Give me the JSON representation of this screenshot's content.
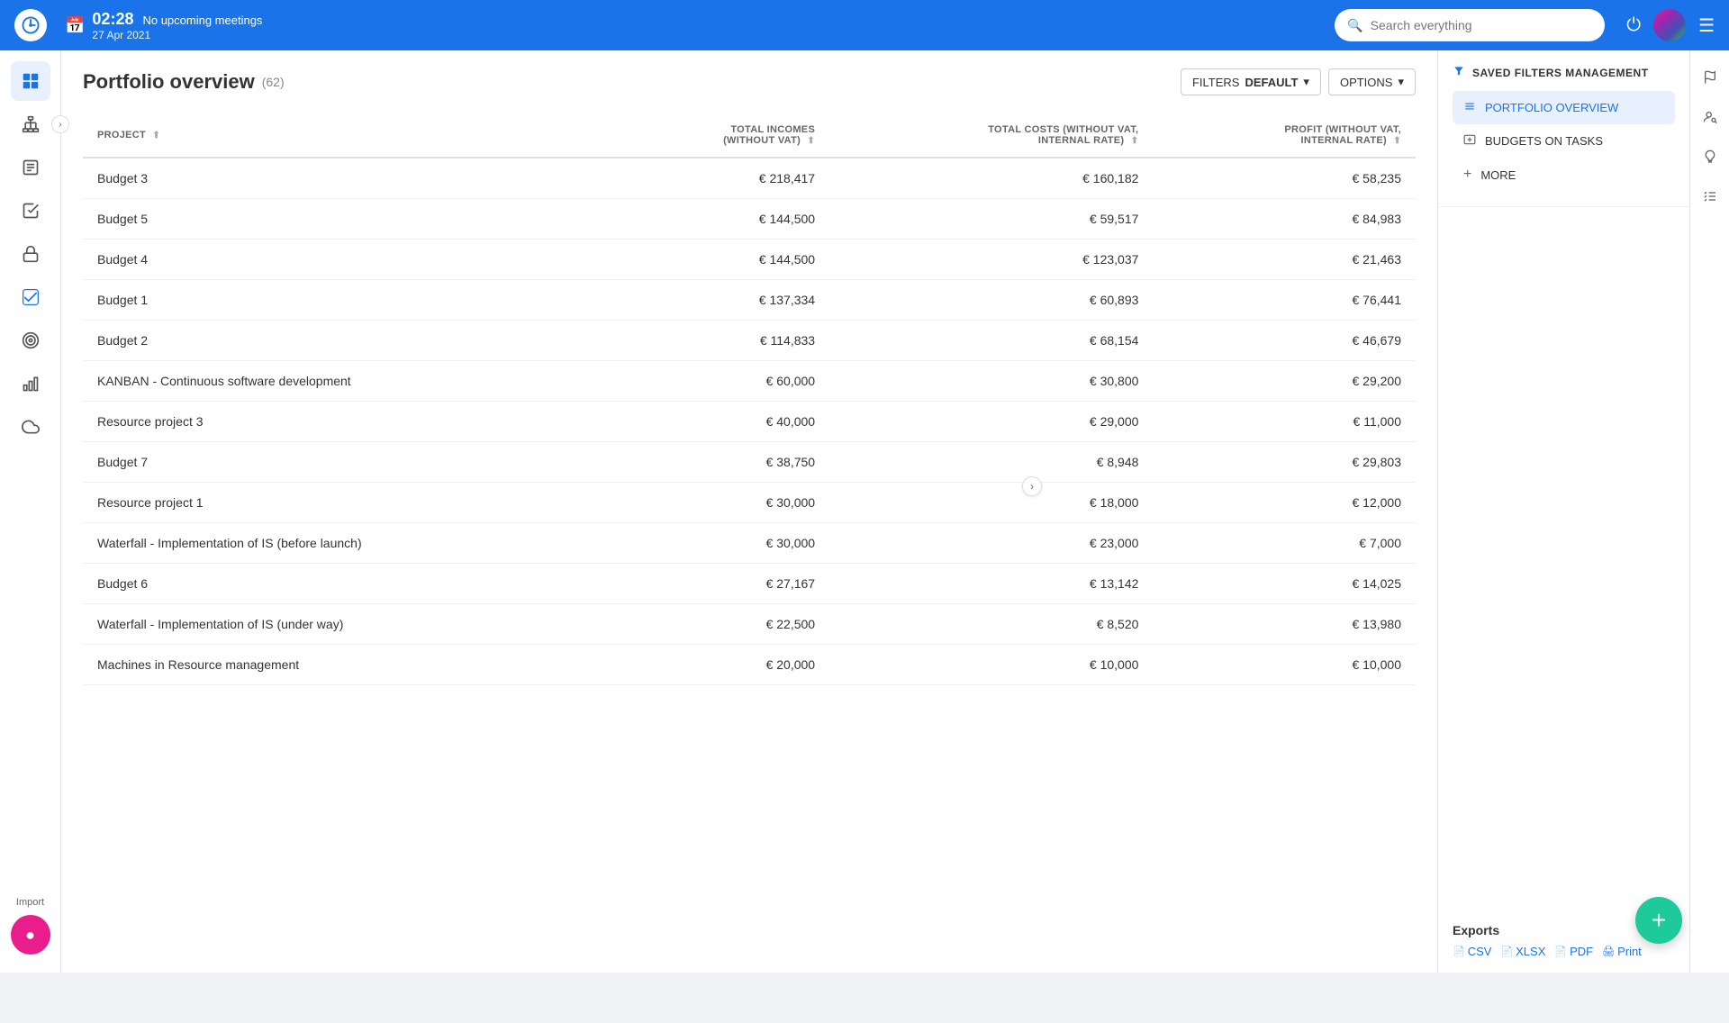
{
  "topnav": {
    "time": "02:28",
    "meeting_status": "No upcoming meetings",
    "date": "27 Apr 2021",
    "search_placeholder": "Search everything"
  },
  "page": {
    "title": "Portfolio overview",
    "count": "(62)",
    "filters_label": "FILTERS",
    "filters_value": "DEFAULT",
    "options_label": "OPTIONS"
  },
  "table": {
    "columns": [
      {
        "id": "project",
        "label": "PROJECT"
      },
      {
        "id": "total_incomes",
        "label": "TOTAL INCOMES (WITHOUT VAT)"
      },
      {
        "id": "total_costs",
        "label": "TOTAL COSTS (WITHOUT VAT, INTERNAL RATE)"
      },
      {
        "id": "profit",
        "label": "PROFIT (WITHOUT VAT, INTERNAL RATE)"
      }
    ],
    "rows": [
      {
        "project": "Budget 3",
        "total_incomes": "€ 218,417",
        "total_costs": "€ 160,182",
        "profit": "€ 58,235"
      },
      {
        "project": "Budget 5",
        "total_incomes": "€ 144,500",
        "total_costs": "€ 59,517",
        "profit": "€ 84,983"
      },
      {
        "project": "Budget 4",
        "total_incomes": "€ 144,500",
        "total_costs": "€ 123,037",
        "profit": "€ 21,463"
      },
      {
        "project": "Budget 1",
        "total_incomes": "€ 137,334",
        "total_costs": "€ 60,893",
        "profit": "€ 76,441"
      },
      {
        "project": "Budget 2",
        "total_incomes": "€ 114,833",
        "total_costs": "€ 68,154",
        "profit": "€ 46,679"
      },
      {
        "project": "KANBAN - Continuous software development",
        "total_incomes": "€ 60,000",
        "total_costs": "€ 30,800",
        "profit": "€ 29,200"
      },
      {
        "project": "Resource project 3",
        "total_incomes": "€ 40,000",
        "total_costs": "€ 29,000",
        "profit": "€ 11,000"
      },
      {
        "project": "Budget 7",
        "total_incomes": "€ 38,750",
        "total_costs": "€ 8,948",
        "profit": "€ 29,803"
      },
      {
        "project": "Resource project 1",
        "total_incomes": "€ 30,000",
        "total_costs": "€ 18,000",
        "profit": "€ 12,000"
      },
      {
        "project": "Waterfall - Implementation of IS (before launch)",
        "total_incomes": "€ 30,000",
        "total_costs": "€ 23,000",
        "profit": "€ 7,000"
      },
      {
        "project": "Budget 6",
        "total_incomes": "€ 27,167",
        "total_costs": "€ 13,142",
        "profit": "€ 14,025"
      },
      {
        "project": "Waterfall - Implementation of IS (under way)",
        "total_incomes": "€ 22,500",
        "total_costs": "€ 8,520",
        "profit": "€ 13,980"
      },
      {
        "project": "Machines in Resource management",
        "total_incomes": "€ 20,000",
        "total_costs": "€ 10,000",
        "profit": "€ 10,000"
      }
    ]
  },
  "right_panel": {
    "saved_filters_label": "SAVED FILTERS MANAGEMENT",
    "menu_items": [
      {
        "id": "portfolio-overview",
        "label": "PORTFOLIO OVERVIEW",
        "active": true
      },
      {
        "id": "budgets-on-tasks",
        "label": "BUDGETS ON TASKS",
        "active": false
      }
    ],
    "more_label": "MORE",
    "exports": {
      "title": "Exports",
      "links": [
        "CSV",
        "XLSX",
        "PDF",
        "Print"
      ]
    }
  },
  "sidebar": {
    "items": [
      {
        "id": "dashboard",
        "icon": "⊞",
        "active": true
      },
      {
        "id": "hierarchy",
        "icon": "⋮≡",
        "active": false
      },
      {
        "id": "tasks",
        "icon": "📋",
        "active": false
      },
      {
        "id": "checklist",
        "icon": "✓≡",
        "active": false
      },
      {
        "id": "lock",
        "icon": "🔒",
        "active": false
      },
      {
        "id": "check",
        "icon": "☑",
        "active": false
      },
      {
        "id": "target",
        "icon": "◎",
        "active": false
      },
      {
        "id": "chart",
        "icon": "📊",
        "active": false
      },
      {
        "id": "cloud",
        "icon": "☁",
        "active": false
      }
    ],
    "import_label": "Import"
  },
  "fab": {
    "label": "+"
  }
}
